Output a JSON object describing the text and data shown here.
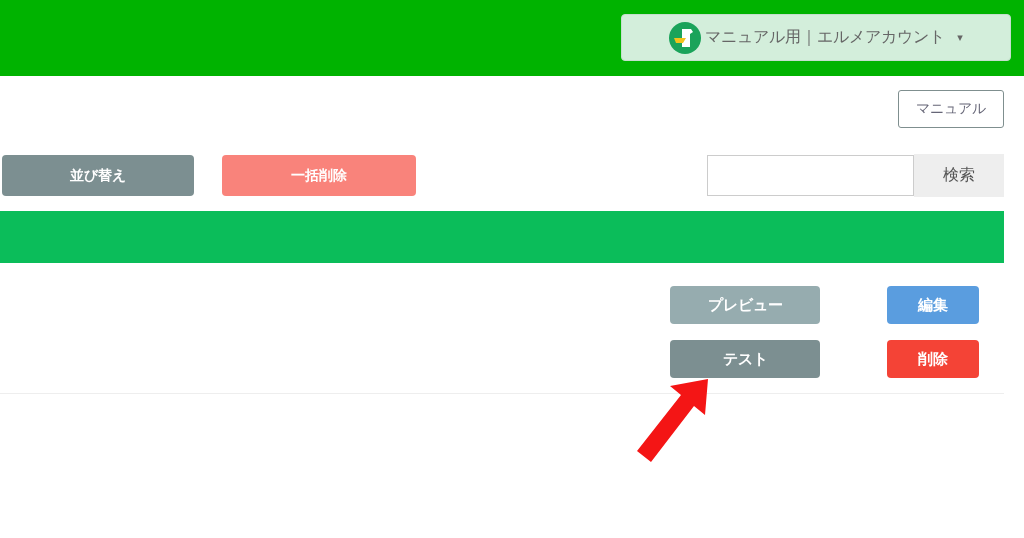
{
  "header": {
    "account": {
      "name": "マニュアル用｜エルメアカウント",
      "caret": "▾"
    }
  },
  "toolbar": {
    "manual_button": "マニュアル",
    "sort_button": "並び替え",
    "bulk_delete_button": "一括削除",
    "search": {
      "button": "検索"
    }
  },
  "list": {
    "rows": [
      {
        "preview_button": "プレビュー",
        "edit_button": "編集",
        "test_button": "テスト",
        "delete_button": "削除"
      }
    ]
  }
}
